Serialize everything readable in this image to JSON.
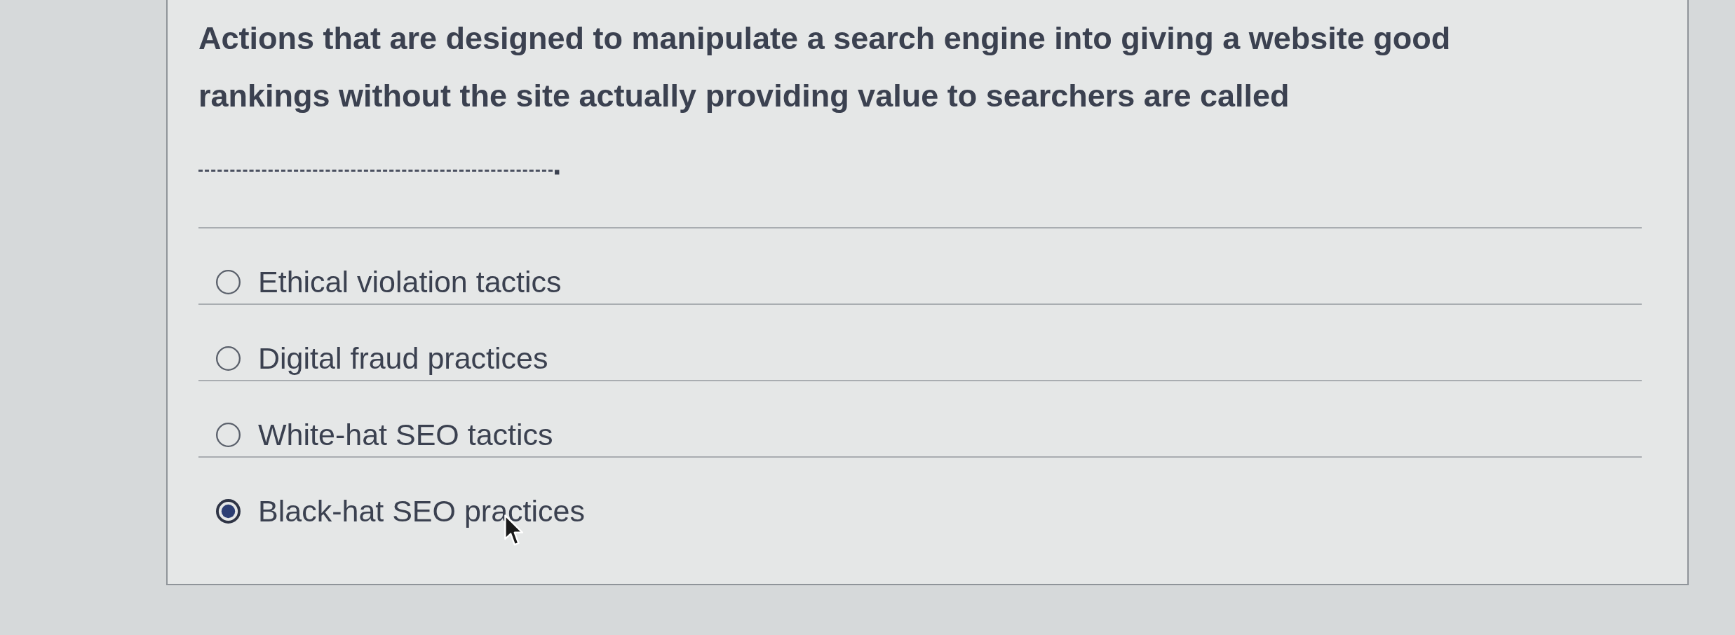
{
  "question": {
    "text": "Actions that are designed to manipulate a search engine into giving a website good rankings without the site actually providing value to searchers are called",
    "blank_end": "."
  },
  "options": [
    {
      "label": "Ethical violation tactics",
      "selected": false
    },
    {
      "label": "Digital fraud practices",
      "selected": false
    },
    {
      "label": "White-hat SEO tactics",
      "selected": false
    },
    {
      "label": "Black-hat SEO practices",
      "selected": true
    }
  ]
}
